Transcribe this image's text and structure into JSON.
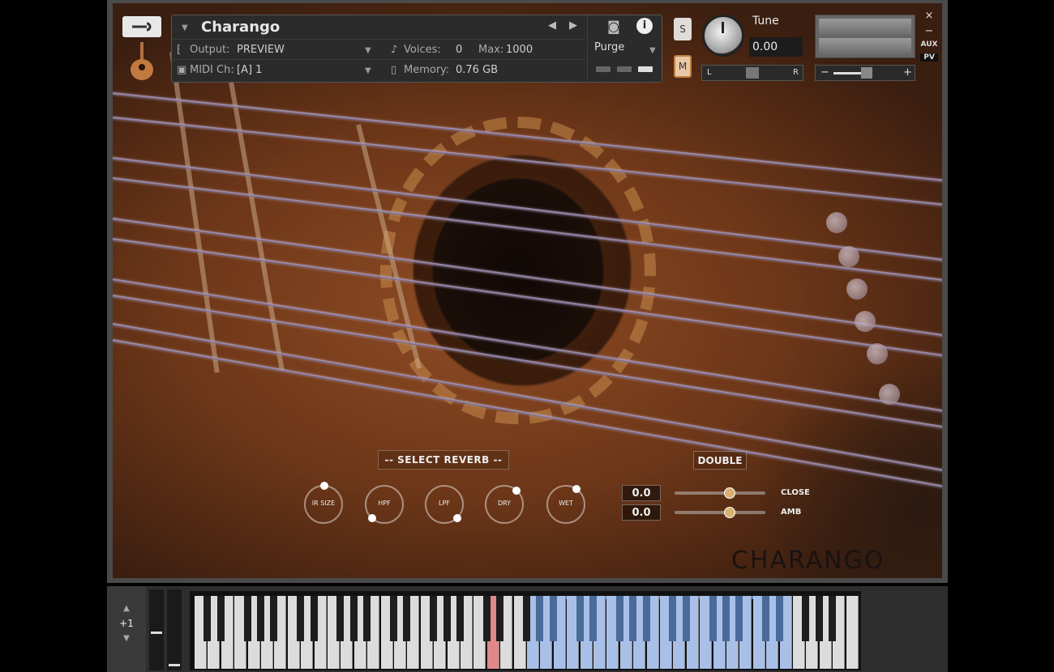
{
  "header": {
    "instrument_name": "Charango",
    "output_label": "Output:",
    "output_value": "PREVIEW",
    "voices_label": "Voices:",
    "voices_value": "0",
    "max_label": "Max:",
    "max_value": "1000",
    "midi_label": "MIDI Ch:",
    "midi_value": "[A]  1",
    "memory_label": "Memory:",
    "memory_value": "0.76 GB",
    "purge_label": "Purge",
    "solo_label": "S",
    "mute_label": "M",
    "tune_label": "Tune",
    "tune_value": "0.00",
    "pan_left": "L",
    "pan_right": "R",
    "vol_minus": "−",
    "vol_plus": "+",
    "close_glyph": "×",
    "minimize_glyph": "−",
    "aux_label": "AUX",
    "pv_label": "PV"
  },
  "controls": {
    "select_reverb": "-- SELECT REVERB --",
    "double_label": "DOUBLE",
    "knobs": [
      {
        "label": "IR SIZE"
      },
      {
        "label": "HPF"
      },
      {
        "label": "LPF"
      },
      {
        "label": "DRY"
      },
      {
        "label": "WET"
      }
    ],
    "close_value": "0.0",
    "close_label": "CLOSE",
    "close_level": 0.62,
    "amb_value": "0.0",
    "amb_label": "AMB",
    "amb_level": 0.62
  },
  "brand": "CHARANGO",
  "keyboard": {
    "octave_up": "▲",
    "octave_value": "+1",
    "octave_down": "▼"
  },
  "colors": {
    "accent_blue": "#a8c0e8",
    "accent_red": "#e08888",
    "knob_amber": "#d8b070"
  },
  "icons": [
    "wrench-icon",
    "charango-thumbnail-icon",
    "prev-arrow-icon",
    "next-arrow-icon",
    "camera-icon",
    "info-icon",
    "output-icon",
    "voices-icon",
    "midi-icon",
    "memory-icon"
  ]
}
